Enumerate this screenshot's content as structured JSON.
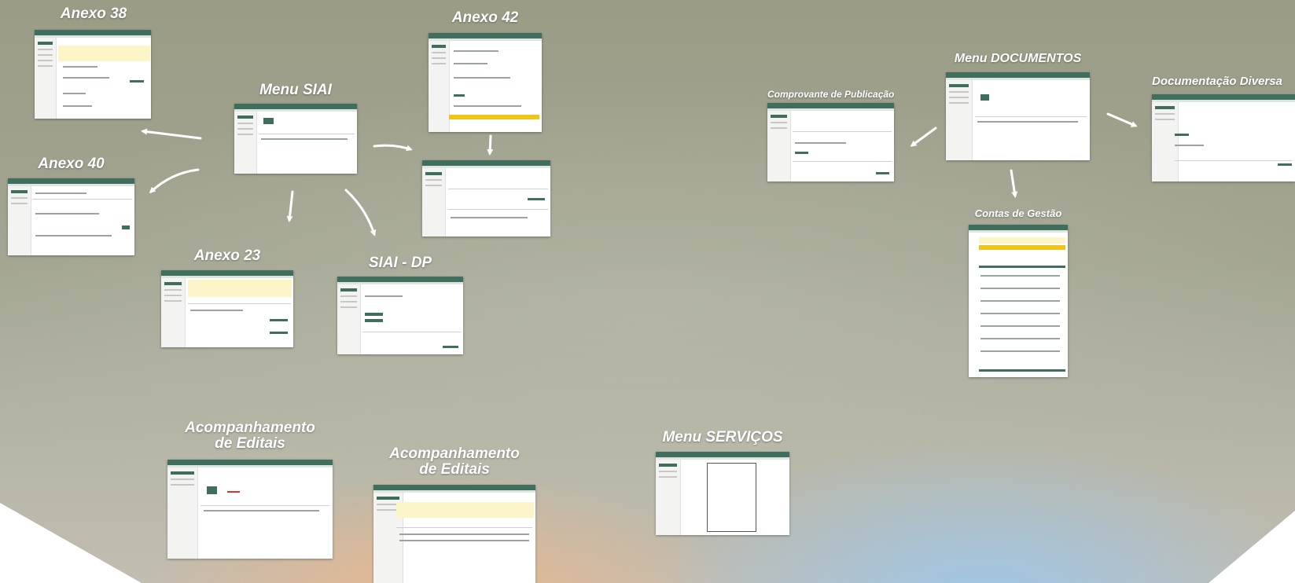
{
  "canvas": {
    "background_colors": [
      "#9a9c86",
      "#b5b5a6",
      "#e9b78e",
      "#9fc6e6"
    ]
  },
  "nodes": {
    "anexo38": {
      "title": "Anexo 38"
    },
    "menu_siai": {
      "title": "Menu SIAI"
    },
    "anexo42": {
      "title": "Anexo 42"
    },
    "anexo40": {
      "title": "Anexo 40"
    },
    "anexo23": {
      "title": "Anexo 23"
    },
    "siai_dp": {
      "title": "SIAI - DP"
    },
    "acomp_editais_1": {
      "title_line1": "Acompanhamento",
      "title_line2": "de Editais"
    },
    "acomp_editais_2": {
      "title_line1": "Acompanhamento",
      "title_line2": "de Editais"
    },
    "menu_servicos": {
      "title": "Menu SERVIÇOS"
    },
    "comprovante": {
      "title": "Comprovante de Publicação"
    },
    "menu_documentos": {
      "title": "Menu DOCUMENTOS"
    },
    "documentacao_diversa": {
      "title": "Documentação Diversa"
    },
    "contas_gestao": {
      "title": "Contas de Gestão"
    }
  },
  "colors": {
    "app_header": "#3f6e5c",
    "title_text": "#ffffff",
    "arrow": "#ffffff",
    "highlight_yellow": "#fbf5c8",
    "warning_bar": "#f0c419"
  }
}
